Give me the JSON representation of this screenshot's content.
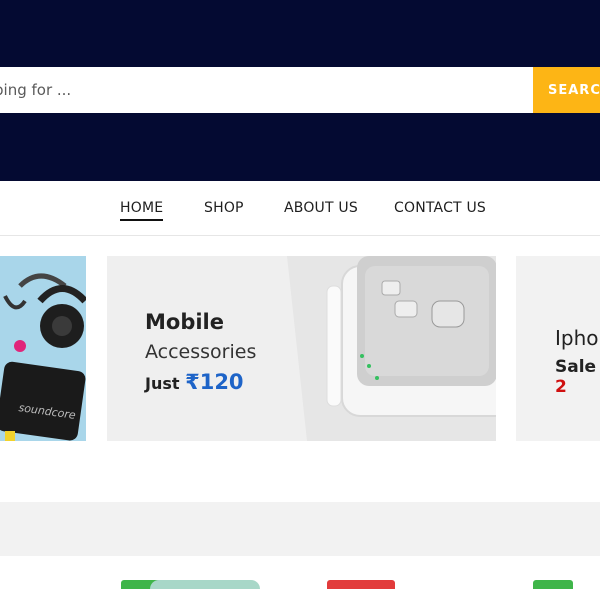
{
  "search": {
    "placeholder": "ping for ...",
    "button_label": "SEARCH"
  },
  "nav": {
    "items": [
      {
        "label": "HOME",
        "active": true
      },
      {
        "label": "SHOP"
      },
      {
        "label": "ABOUT US"
      },
      {
        "label": "CONTACT US"
      }
    ]
  },
  "banners": [
    {
      "brand": "soundcore"
    },
    {
      "title": "Mobile",
      "subtitle": "Accessories",
      "price_prefix": "Just",
      "price": "₹120"
    },
    {
      "title": "Ipho",
      "sale_prefix": "Sale",
      "sale_value": "2"
    }
  ],
  "colors": {
    "header_bg": "#040a32",
    "search_button": "#fdb515",
    "price_accent": "#1e64c8",
    "sale_accent": "#d01010"
  }
}
